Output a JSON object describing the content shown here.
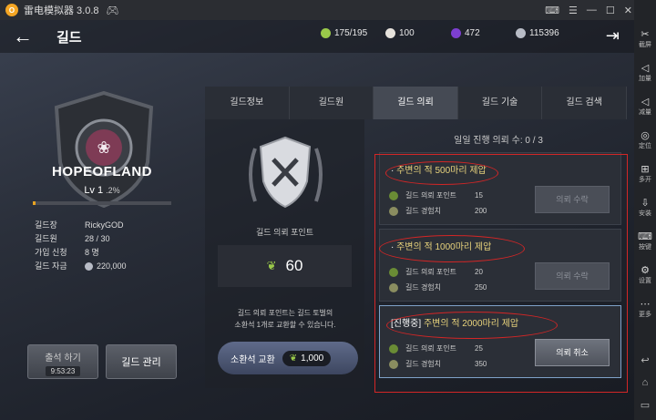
{
  "emulator": {
    "title": "雷电模拟器 3.0.8",
    "logo_letter": "O"
  },
  "side_buttons": [
    {
      "glyph": "✂",
      "label": "截屏"
    },
    {
      "glyph": "◁",
      "label": "加量"
    },
    {
      "glyph": "◁",
      "label": "减量"
    },
    {
      "glyph": "◎",
      "label": "定位"
    },
    {
      "glyph": "⊞",
      "label": "多开"
    },
    {
      "glyph": "⇩",
      "label": "安装"
    },
    {
      "glyph": "⌨",
      "label": "按键"
    },
    {
      "glyph": "⚙",
      "label": "设置"
    },
    {
      "glyph": "⋯",
      "label": "更多"
    }
  ],
  "header": {
    "title": "길드",
    "resources": [
      {
        "icon": "stamina-icon",
        "value": "175/195",
        "color": "#9ac94a"
      },
      {
        "icon": "pearl-icon",
        "value": "100",
        "color": "#e6e2dc"
      },
      {
        "icon": "purple-gem-icon",
        "value": "472",
        "color": "#7d3fd1"
      },
      {
        "icon": "silver-coin-icon",
        "value": "115396",
        "color": "#b8bcc6"
      }
    ]
  },
  "guild": {
    "name": "HOPEOFLAND",
    "level": "Lv 1",
    "level_pct": ".2%",
    "xp_fraction": 0.02,
    "info": [
      {
        "k": "길드장",
        "v": "RickyGOD"
      },
      {
        "k": "길드원",
        "v": "28 / 30"
      },
      {
        "k": "가입 신청",
        "v": "8 명"
      },
      {
        "k": "길드 자금",
        "v": "220,000"
      }
    ],
    "attend_label": "출석 하기",
    "attend_timer": "9:53:23",
    "manage_label": "길드 관리"
  },
  "tabs": [
    "길드정보",
    "길드원",
    "길드 의뢰",
    "길드 기술",
    "길드 검색"
  ],
  "active_tab": 2,
  "points": {
    "label": "길드 의뢰 포인트",
    "value": "60",
    "desc1": "길드 의뢰 포인트는 길드 토벌의",
    "desc2": "소환석 1개로 교환할 수 있습니다.",
    "exchange_label": "소환석 교환",
    "exchange_cost": "1,000"
  },
  "daily": "일일 진행 의뢰 수: 0 / 3",
  "quests": [
    {
      "prefix": "",
      "title": "주변의 적 500마리 제압",
      "r1name": "길드 의뢰 포인트",
      "r1": "15",
      "r2name": "길드 경험치",
      "r2": "200",
      "btn": "의뢰 수락"
    },
    {
      "prefix": "",
      "title": "주변의 적 1000마리 제압",
      "r1name": "길드 의뢰 포인트",
      "r1": "20",
      "r2name": "길드 경험치",
      "r2": "250",
      "btn": "의뢰 수락"
    },
    {
      "prefix": "[진행중]",
      "title": "주변의 적 2000마리 제압",
      "r1name": "길드 의뢰 포인트",
      "r1": "25",
      "r2name": "길드 경험치",
      "r2": "350",
      "btn": "의뢰 취소"
    }
  ]
}
